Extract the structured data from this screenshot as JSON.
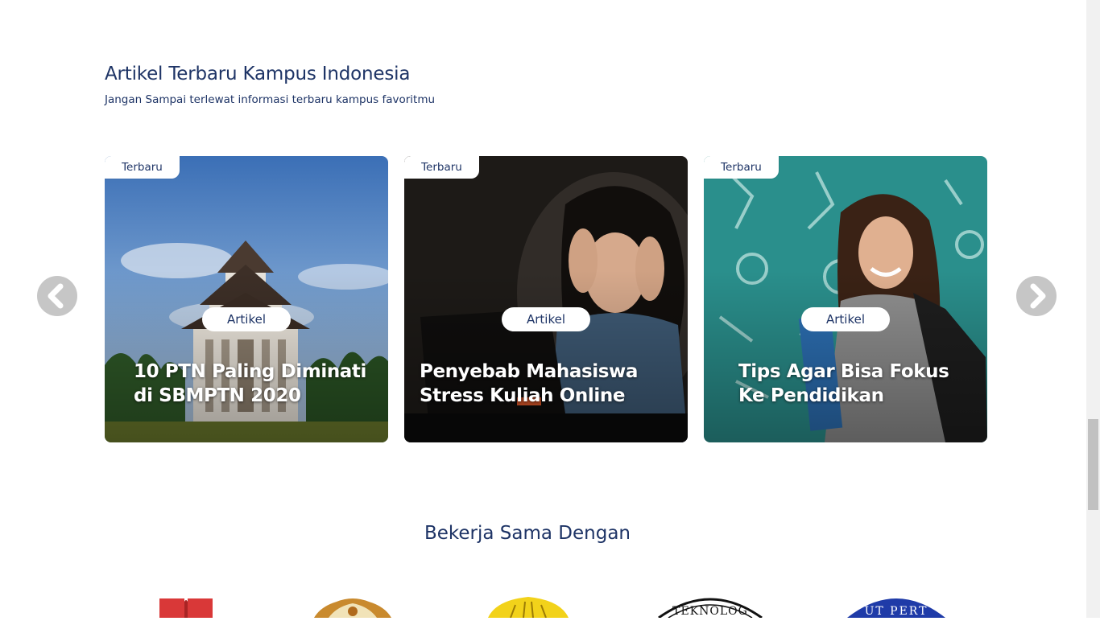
{
  "section": {
    "title": "Artikel Terbaru Kampus Indonesia",
    "subtitle": "Jangan Sampai terlewat informasi terbaru kampus favoritmu"
  },
  "articles": [
    {
      "badge": "Terbaru",
      "category": "Artikel",
      "title": "10 PTN Paling Diminati di SBMPTN 2020"
    },
    {
      "badge": "Terbaru",
      "category": "Artikel",
      "title": "Penyebab Mahasiswa Stress Kuliah Online"
    },
    {
      "badge": "Terbaru",
      "category": "Artikel",
      "title": "Tips Agar Bisa Fokus Ke Pendidikan"
    }
  ],
  "carousel": {
    "prev_icon": "chevron-left-icon",
    "next_icon": "chevron-right-icon"
  },
  "partners": {
    "title": "Bekerja Sama Dengan",
    "logos": [
      "book-logo",
      "shield-crest-logo",
      "yellow-crest-logo",
      "teknologi-seal-logo",
      "blue-seal-logo"
    ],
    "seal_text_1": "TEKNOLOG",
    "seal_text_2": "UT PERT"
  },
  "colors": {
    "heading": "#1e3466",
    "arrow": "#c6c6c6",
    "background": "#ffffff"
  }
}
